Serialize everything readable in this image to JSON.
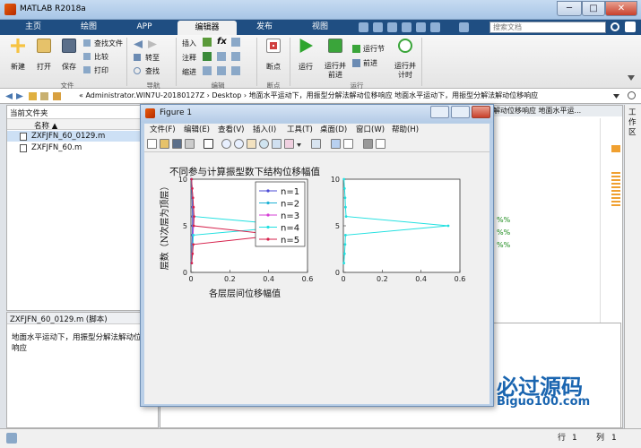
{
  "app": {
    "title": "MATLAB R2018a"
  },
  "colors": {
    "tabbar": "#1f4e82",
    "accent": "#e85c0d",
    "series1": "#4b4bd6",
    "series2": "#20b2d6",
    "series3": "#d640d6",
    "series4": "#20e0e0",
    "series5": "#d6204b"
  },
  "window_controls": {
    "minimize": "─",
    "maximize": "□",
    "close": "✕"
  },
  "tabs": [
    {
      "label": "主页"
    },
    {
      "label": "绘图"
    },
    {
      "label": "APP"
    },
    {
      "label": "编辑器"
    },
    {
      "label": "发布"
    },
    {
      "label": "视图"
    }
  ],
  "search": {
    "placeholder": "搜索文档"
  },
  "ribbon": {
    "file": {
      "new": "新建",
      "open": "打开",
      "save": "保存",
      "find_files": "查找文件",
      "compare": "比较",
      "print": "打印",
      "group": "文件"
    },
    "nav": {
      "goto": "转至",
      "find": "查找",
      "group": "导航"
    },
    "edit": {
      "insert": "插入",
      "comment": "注释",
      "indent": "缩进",
      "fx": "fx",
      "group": "编辑"
    },
    "breakpoints": {
      "label": "断点",
      "group": "断点"
    },
    "run": {
      "run": "运行",
      "run_advance_1": "运行并",
      "run_advance_2": "前进",
      "run_section": "运行节",
      "advance": "前进",
      "run_time_1": "运行并",
      "run_time_2": "计时",
      "group": "运行"
    }
  },
  "address": {
    "path": "« Administrator.WIN7U-20180127Z › Desktop › 地面水平运动下，用振型分解法解动位移响应 地面水平运动下，用振型分解法解动位移响应"
  },
  "left_pane": {
    "header": "当前文件夹",
    "col_name": "名称 ▲",
    "files": [
      "ZXFJFN_60_0129.m",
      "ZXFJFN_60.m"
    ]
  },
  "details": {
    "header": "ZXFJFN_60_0129.m  (脚本)",
    "desc": "地面水平运动下，用振型分解法解动位移响应"
  },
  "right_pane": {
    "header": "工作区"
  },
  "editor_tabs": {
    "text": "解动位移响应  地面水平运..."
  },
  "code_markers": [
    "%%",
    "%%",
    "%%"
  ],
  "status": {
    "row_label": "行",
    "row": "1",
    "col_label": "列",
    "col": "1"
  },
  "watermark": {
    "brand": "必过源码",
    "url": "Biguo100.com"
  },
  "figure": {
    "title": "Figure 1",
    "menu": [
      "文件(F)",
      "编辑(E)",
      "查看(V)",
      "插入(I)",
      "工具(T)",
      "桌面(D)",
      "窗口(W)",
      "帮助(H)"
    ],
    "chart_data": [
      {
        "type": "line",
        "title": "不同参与计算振型数下结构位移幅值",
        "xlabel": "各层层间位移幅值",
        "ylabel": "层数（N次层为顶层）",
        "xlim": [
          0,
          0.6
        ],
        "ylim": [
          0,
          10
        ],
        "xticks": [
          "0",
          "0.2",
          "0.4",
          "0.6"
        ],
        "yticks": [
          "0",
          "5",
          "10"
        ],
        "legend_position": "top-right",
        "y": [
          1,
          2,
          3,
          4,
          5,
          6,
          7,
          8,
          9,
          10
        ],
        "series": [
          {
            "name": "n=1",
            "x": [
              0.003,
              0.005,
              0.006,
              0.007,
              0.008,
              0.008,
              0.007,
              0.006,
              0.004,
              0.002
            ]
          },
          {
            "name": "n=2",
            "x": [
              0.003,
              0.006,
              0.008,
              0.01,
              0.011,
              0.011,
              0.01,
              0.008,
              0.005,
              0.002
            ]
          },
          {
            "name": "n=3",
            "x": [
              0.003,
              0.006,
              0.009,
              0.011,
              0.013,
              0.013,
              0.011,
              0.009,
              0.006,
              0.003
            ]
          },
          {
            "name": "n=4",
            "x": [
              0.003,
              0.007,
              0.01,
              0.012,
              0.55,
              0.015,
              0.012,
              0.009,
              0.006,
              0.003
            ]
          },
          {
            "name": "n=5",
            "x": [
              0.004,
              0.008,
              0.012,
              0.45,
              0.014,
              0.016,
              0.013,
              0.01,
              0.006,
              0.003
            ]
          }
        ]
      },
      {
        "type": "line",
        "xlim": [
          0,
          0.6
        ],
        "ylim": [
          0,
          10
        ],
        "xticks": [
          "0",
          "0.2",
          "0.4",
          "0.6"
        ],
        "yticks": [
          "0",
          "5",
          "10"
        ],
        "y": [
          1,
          2,
          3,
          4,
          5,
          6,
          7,
          8,
          9,
          10
        ],
        "series": [
          {
            "x": [
              0.003,
              0.006,
              0.009,
              0.011,
              0.54,
              0.014,
              0.011,
              0.009,
              0.006,
              0.003
            ]
          }
        ]
      }
    ]
  }
}
